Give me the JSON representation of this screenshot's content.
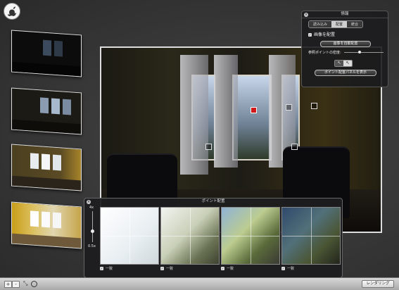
{
  "app": {
    "logo_text": "Ａ Ａ Ａ"
  },
  "info_panel": {
    "title": "情報",
    "tabs": [
      {
        "label": "読み込み",
        "active": false
      },
      {
        "label": "配置",
        "active": true
      },
      {
        "label": "統合",
        "active": false
      }
    ],
    "align_images_checkbox": {
      "label": "画像を配置",
      "checked": true
    },
    "auto_align_button": "画像を自動配置",
    "ref_point_label": "参照ポイントの密度:",
    "show_point_panel_button": "ポイント配置パネルを表示"
  },
  "point_panel": {
    "title": "ポイント配置",
    "zoom_max": "4x",
    "zoom_min": "0.5x",
    "images": [
      {
        "label": "一致",
        "checked": true
      },
      {
        "label": "一致",
        "checked": true
      },
      {
        "label": "一致",
        "checked": true
      },
      {
        "label": "一致",
        "checked": true
      }
    ]
  },
  "bottom_bar": {
    "add_label": "+",
    "remove_label": "-",
    "render_button": "レンダリング"
  },
  "colors": {
    "marker_active": "#d01818",
    "window_bg": "#3a3a3a"
  }
}
